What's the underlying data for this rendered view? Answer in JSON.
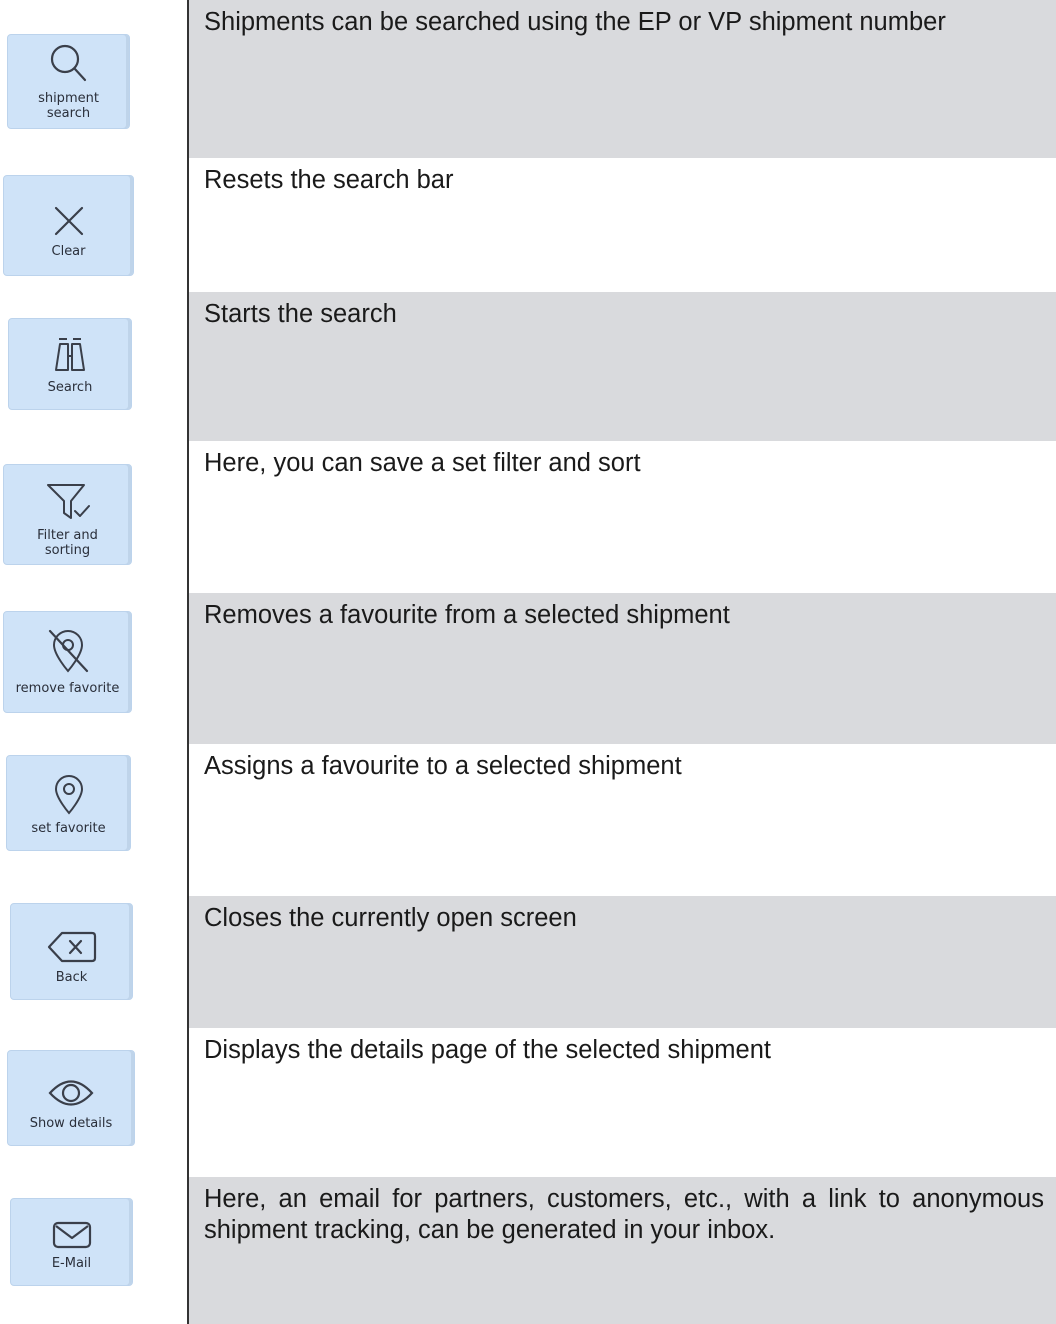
{
  "rows": [
    {
      "button_label": "shipment search",
      "icon": "search-icon",
      "description": "Shipments can be searched using the EP or VP shipment number"
    },
    {
      "button_label": "Clear",
      "icon": "close-icon",
      "description": "Resets the search bar"
    },
    {
      "button_label": "Search",
      "icon": "binoculars-icon",
      "description": "Starts the search"
    },
    {
      "button_label": "Filter and sorting",
      "icon": "filter-check-icon",
      "description": "Here, you can save a set filter and sort"
    },
    {
      "button_label": "remove favorite",
      "icon": "location-pin-off-icon",
      "description": "Removes a favourite from a selected shipment"
    },
    {
      "button_label": "set favorite",
      "icon": "location-pin-icon",
      "description": "Assigns a favourite to a selected shipment"
    },
    {
      "button_label": "Back",
      "icon": "backspace-icon",
      "description": "Closes the currently open screen"
    },
    {
      "button_label": "Show details",
      "icon": "eye-icon",
      "description": "Displays the details page of the selected shipment"
    },
    {
      "button_label": "E-Mail",
      "icon": "envelope-icon",
      "description": "Here, an email for partners, customers, etc., with a link to anonymous shipment tracking, can be generated in your inbox."
    }
  ],
  "colors": {
    "button_bg": "#cfe3f8",
    "row_shade": "#d9dadd",
    "divider": "#333333"
  }
}
